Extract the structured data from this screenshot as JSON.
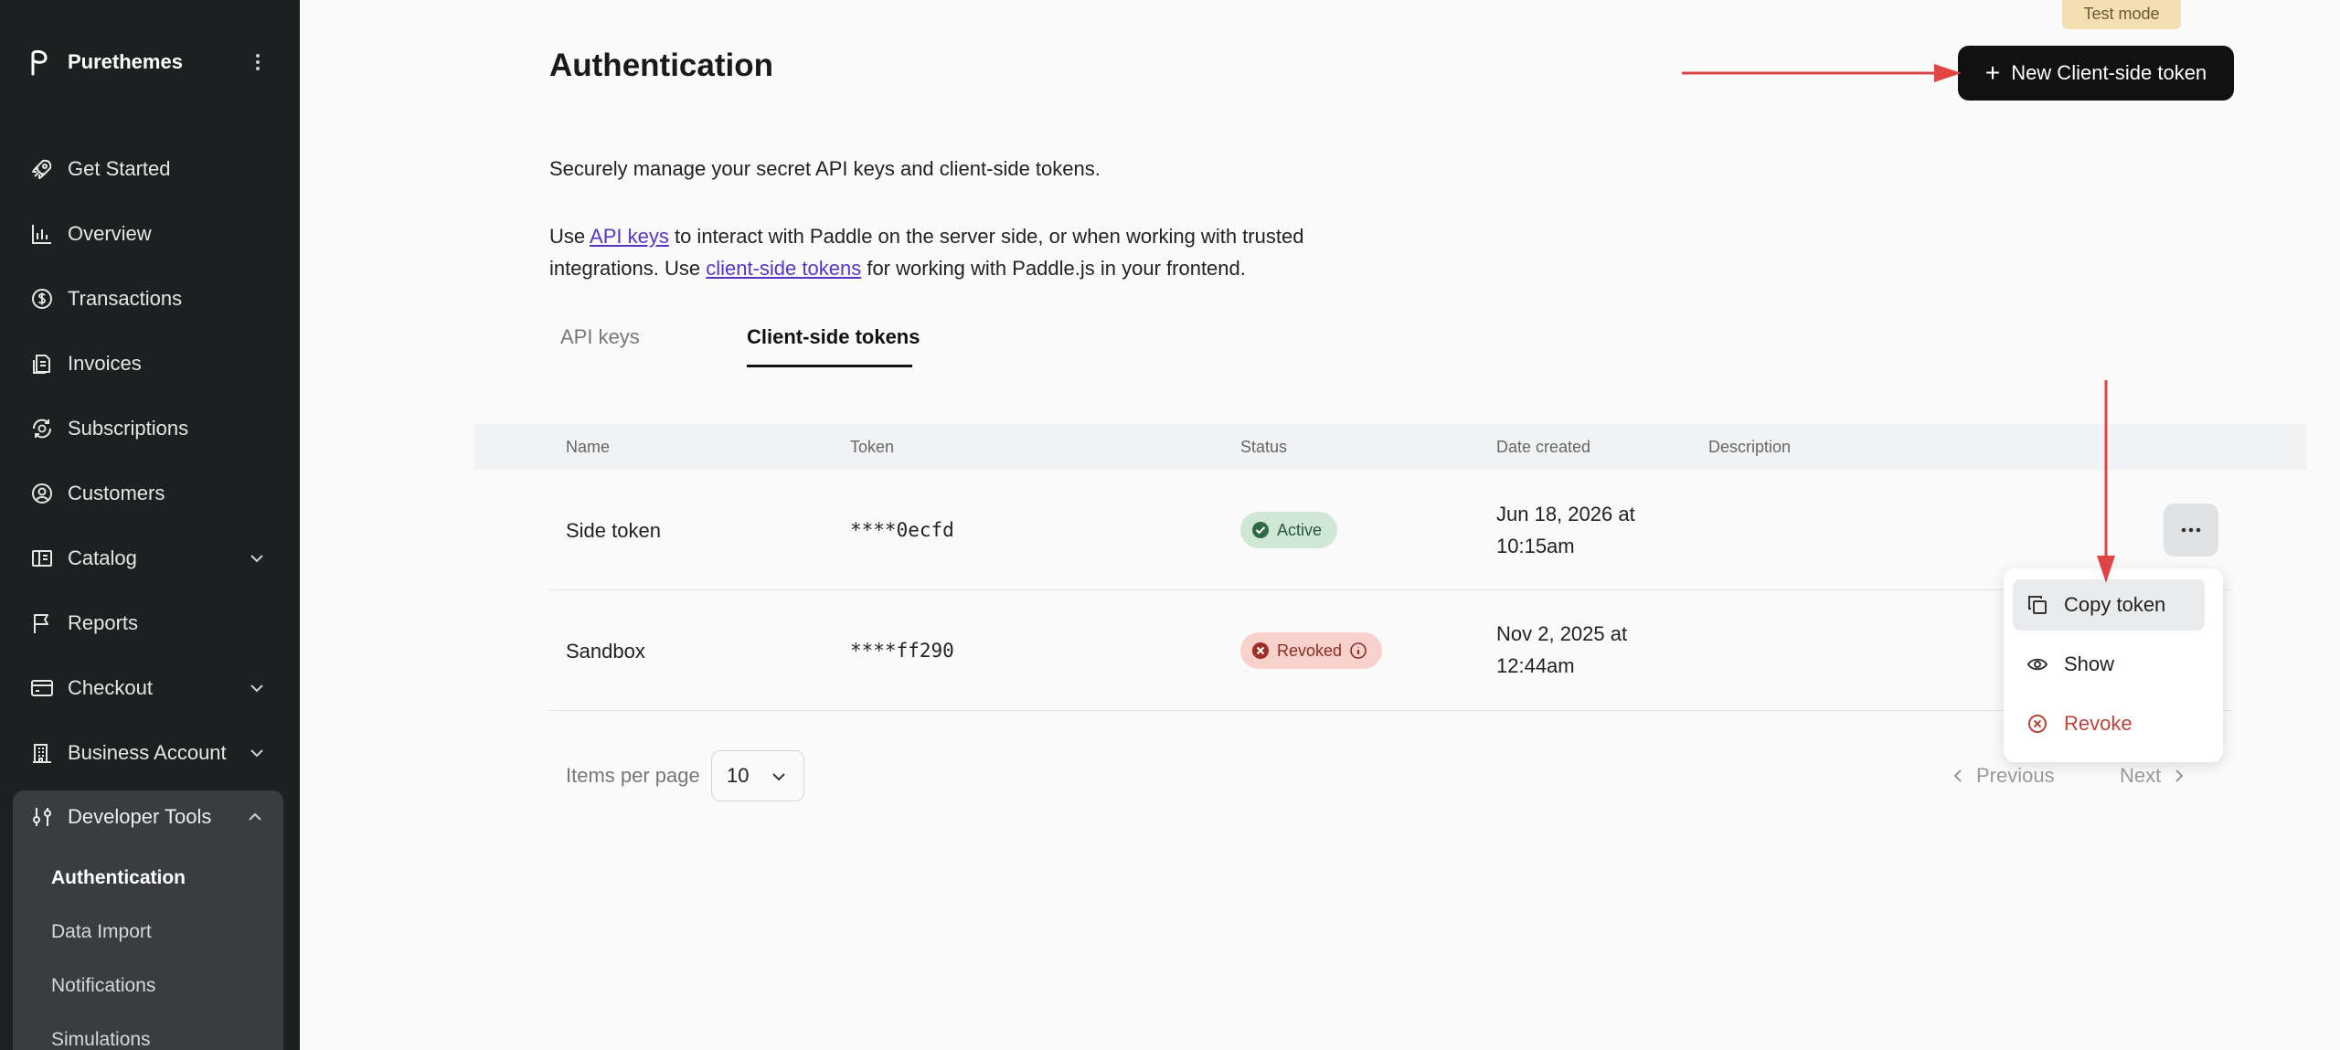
{
  "sidebar": {
    "brand": "Purethemes",
    "items": [
      {
        "label": "Get Started",
        "icon": "rocket-icon"
      },
      {
        "label": "Overview",
        "icon": "bar-chart-icon"
      },
      {
        "label": "Transactions",
        "icon": "dollar-circle-icon"
      },
      {
        "label": "Invoices",
        "icon": "invoice-icon"
      },
      {
        "label": "Subscriptions",
        "icon": "subscription-icon"
      },
      {
        "label": "Customers",
        "icon": "user-circle-icon"
      },
      {
        "label": "Catalog",
        "icon": "catalog-icon"
      },
      {
        "label": "Reports",
        "icon": "flag-icon"
      },
      {
        "label": "Checkout",
        "icon": "card-icon"
      },
      {
        "label": "Business Account",
        "icon": "building-icon"
      }
    ],
    "developer_tools": {
      "label": "Developer Tools",
      "items": [
        "Authentication",
        "Data Import",
        "Notifications",
        "Simulations"
      ]
    }
  },
  "header": {
    "test_mode": "Test mode",
    "title": "Authentication",
    "new_token_button": "New Client-side token"
  },
  "intro": {
    "line1": "Securely manage your secret API keys and client-side tokens.",
    "use": "Use",
    "api_keys_link": "API keys",
    "mid": "to interact with Paddle on the server side, or when working with trusted integrations. Use",
    "client_tokens_link": "client-side tokens",
    "end": "for working with Paddle.js in your frontend."
  },
  "tabs": [
    "API keys",
    "Client-side tokens"
  ],
  "table": {
    "columns": [
      "Name",
      "Token",
      "Status",
      "Date created",
      "Description"
    ],
    "rows": [
      {
        "name": "Side token",
        "token": "****0ecfd",
        "status": "Active",
        "date_line1": "Jun 18, 2026 at",
        "date_line2": "10:15am",
        "description": ""
      },
      {
        "name": "Sandbox",
        "token": "****ff290",
        "status": "Revoked",
        "date_line1": "Nov 2, 2025 at",
        "date_line2": "12:44am",
        "description": ""
      }
    ]
  },
  "row_menu": {
    "items": [
      "Copy token",
      "Show",
      "Revoke"
    ]
  },
  "pagination": {
    "items_per_page_label": "Items per page",
    "items_per_page_value": "10",
    "previous": "Previous",
    "next": "Next"
  },
  "colors": {
    "sidebar_bg": "#1d2021",
    "primary_button": "#111111",
    "link": "#5536c9",
    "active_badge": "#cfe8d6",
    "revoked_badge": "#f8d1cc",
    "annotation_arrow": "#e04545",
    "test_mode_badge": "#f3dfb0"
  }
}
